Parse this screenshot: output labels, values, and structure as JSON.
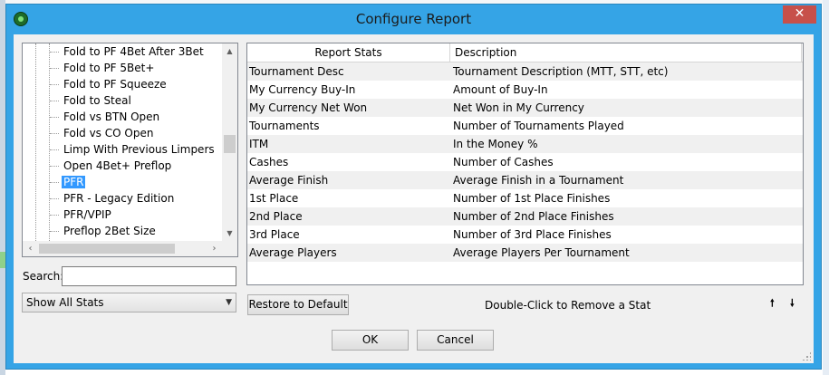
{
  "window": {
    "title": "Configure Report",
    "close_glyph": "✕"
  },
  "tree": {
    "items": [
      "Fold to PF 4Bet After 3Bet",
      "Fold to PF 5Bet+",
      "Fold to PF Squeeze",
      "Fold to Steal",
      "Fold vs BTN Open",
      "Fold vs CO Open",
      "Limp With Previous Limpers",
      "Open 4Bet+ Preflop",
      "PFR",
      "PFR - Legacy Edition",
      "PFR/VPIP",
      "Preflop 2Bet Size"
    ],
    "selected": "PFR"
  },
  "search": {
    "label": "Search:",
    "value": ""
  },
  "filter": {
    "value": "Show All Stats"
  },
  "grid": {
    "headers": [
      "Report Stats",
      "Description"
    ],
    "rows": [
      [
        "Tournament Desc",
        "Tournament Description (MTT, STT, etc)"
      ],
      [
        "My Currency Buy-In",
        "Amount of Buy-In"
      ],
      [
        "My Currency Net Won",
        "Net Won in My Currency"
      ],
      [
        "Tournaments",
        "Number of Tournaments Played"
      ],
      [
        "ITM",
        "In the Money %"
      ],
      [
        "Cashes",
        "Number of Cashes"
      ],
      [
        "Average Finish",
        "Average Finish in a Tournament"
      ],
      [
        "1st Place",
        "Number of 1st Place Finishes"
      ],
      [
        "2nd Place",
        "Number of 2nd Place Finishes"
      ],
      [
        "3rd Place",
        "Number of 3rd Place Finishes"
      ],
      [
        "Average Players",
        "Average Players Per Tournament"
      ]
    ]
  },
  "buttons": {
    "restore": "Restore to Default",
    "ok": "OK",
    "cancel": "Cancel"
  },
  "hint": "Double-Click to Remove a Stat",
  "move_up": "🠕",
  "move_down": "🠗",
  "colors": {
    "title_bar": "#35a4e6",
    "selection": "#3399ff",
    "close": "#c7504a"
  }
}
